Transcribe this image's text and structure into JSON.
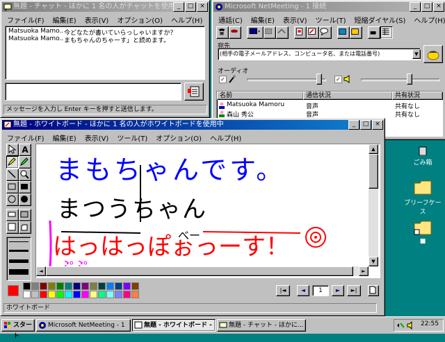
{
  "chat": {
    "title": "無題 - チャット - ほかに 1 名の人がチャットを使用中",
    "menus": [
      "ファイル(F)",
      "編集(E)",
      "表示(V)",
      "オプション(O)",
      "ヘルプ(H)"
    ],
    "messages": [
      {
        "name": "Matsuoka Mamo...",
        "text": "今どなたが書いていらっしゃいますか？"
      },
      {
        "name": "Matsuoka Mamo...",
        "text": "まもちゃんのちゃーす」と読めます。"
      }
    ],
    "status": "メッセージを入力し Enter キーを押すと送信します。"
  },
  "netmeeting": {
    "title": "Microsoft NetMeeting - 1 接続",
    "menus": [
      "通話(C)",
      "編集(E)",
      "表示(V)",
      "ツール(T)",
      "短縮ダイヤル(S)",
      "ヘルプ(H)"
    ],
    "address_label": "宛先",
    "address_placeholder": "(相手の電子メールアドレス、コンピュータ名、または電話番号)",
    "audio_label": "オーディオ",
    "columns": [
      "名前",
      "通信状況",
      "共有状況"
    ],
    "rows": [
      {
        "name": "Matsuoka Mamoru",
        "status": "音声",
        "share": "共有なし"
      },
      {
        "name": "森山 秀公",
        "status": "音声",
        "share": "共有なし"
      }
    ]
  },
  "whiteboard": {
    "title": "無題 - ホワイトボード - ほかに 1 名の人がホワイトボードを使用中",
    "menus": [
      "ファイル(F)",
      "編集(E)",
      "表示(V)",
      "ツール(T)",
      "オプション(O)",
      "ヘルプ(H)"
    ],
    "page_number": "1",
    "status": "ホワイトボード",
    "drawn_text": {
      "line1": "まもちゃんです。",
      "line2": "まつうちゃん",
      "line3": "はっはっぽぉっーす！",
      "line4": "べー",
      "line5": "ぷぷ"
    },
    "palette": [
      "#000000",
      "#808080",
      "#800000",
      "#808000",
      "#008000",
      "#008080",
      "#000080",
      "#800080",
      "#808040",
      "#004040",
      "#0080ff",
      "#004080",
      "#8000ff",
      "#804000",
      "#ffffff",
      "#c0c0c0",
      "#ff0000",
      "#ffff00",
      "#00ff00",
      "#00ffff",
      "#0000ff",
      "#ff00ff",
      "#ffff80",
      "#00ff80",
      "#80ffff",
      "#8080ff",
      "#ff0080",
      "#ff8040"
    ],
    "current_color": "#ff0000"
  },
  "desktop": {
    "icons": [
      {
        "label": "ごみ箱"
      },
      {
        "label": "ブリーフケース"
      },
      {
        "label": "■"
      }
    ]
  },
  "taskbar": {
    "start": "スタート",
    "tasks": [
      "Microsoft NetMeeting - 1",
      "無題 - ホワイトボード - ...",
      "無題 - チャット - ほかに..."
    ],
    "clock": "22:55"
  }
}
